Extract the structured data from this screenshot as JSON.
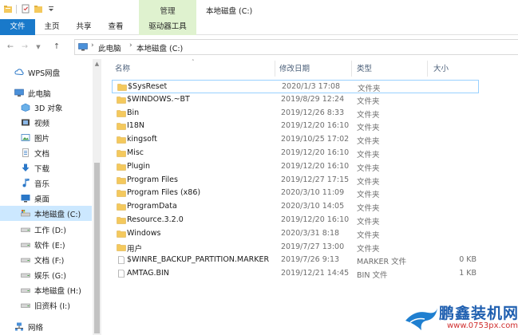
{
  "window": {
    "title": "本地磁盘 (C:)",
    "context_group": "管理"
  },
  "ribbon": {
    "tabs": [
      "文件",
      "主页",
      "共享",
      "查看",
      "驱动器工具"
    ]
  },
  "address": {
    "crumbs": [
      "此电脑",
      "本地磁盘 (C:)"
    ]
  },
  "sidebar": {
    "items": [
      {
        "label": "WPS网盘",
        "icon": "cloud-icon"
      },
      {
        "label": "此电脑",
        "icon": "computer-icon"
      },
      {
        "label": "3D 对象",
        "icon": "3d-objects-icon"
      },
      {
        "label": "视频",
        "icon": "video-icon"
      },
      {
        "label": "图片",
        "icon": "pictures-icon"
      },
      {
        "label": "文档",
        "icon": "documents-icon"
      },
      {
        "label": "下载",
        "icon": "download-icon"
      },
      {
        "label": "音乐",
        "icon": "music-icon"
      },
      {
        "label": "桌面",
        "icon": "desktop-icon"
      },
      {
        "label": "本地磁盘 (C:)",
        "icon": "system-drive-icon"
      },
      {
        "label": "工作 (D:)",
        "icon": "drive-icon"
      },
      {
        "label": "软件 (E:)",
        "icon": "drive-icon"
      },
      {
        "label": "文档 (F:)",
        "icon": "drive-icon"
      },
      {
        "label": "娱乐 (G:)",
        "icon": "drive-icon"
      },
      {
        "label": "本地磁盘 (H:)",
        "icon": "drive-icon"
      },
      {
        "label": "旧资料 (I:)",
        "icon": "drive-icon"
      },
      {
        "label": "网络",
        "icon": "network-icon"
      }
    ]
  },
  "columns": {
    "name": "名称",
    "date": "修改日期",
    "type": "类型",
    "size": "大小"
  },
  "files": [
    {
      "name": "$SysReset",
      "date": "2020/1/3 17:08",
      "type": "文件夹",
      "size": "",
      "icon": "folder-icon"
    },
    {
      "name": "$WINDOWS.~BT",
      "date": "2019/8/29 12:24",
      "type": "文件夹",
      "size": "",
      "icon": "folder-icon"
    },
    {
      "name": "Bin",
      "date": "2019/12/26 8:33",
      "type": "文件夹",
      "size": "",
      "icon": "folder-icon"
    },
    {
      "name": "I18N",
      "date": "2019/12/20 16:10",
      "type": "文件夹",
      "size": "",
      "icon": "folder-icon"
    },
    {
      "name": "kingsoft",
      "date": "2019/10/25 17:02",
      "type": "文件夹",
      "size": "",
      "icon": "folder-icon"
    },
    {
      "name": "Misc",
      "date": "2019/12/20 16:10",
      "type": "文件夹",
      "size": "",
      "icon": "folder-icon"
    },
    {
      "name": "Plugin",
      "date": "2019/12/20 16:10",
      "type": "文件夹",
      "size": "",
      "icon": "folder-icon"
    },
    {
      "name": "Program Files",
      "date": "2019/12/27 17:15",
      "type": "文件夹",
      "size": "",
      "icon": "folder-icon"
    },
    {
      "name": "Program Files (x86)",
      "date": "2020/3/10 11:09",
      "type": "文件夹",
      "size": "",
      "icon": "folder-icon"
    },
    {
      "name": "ProgramData",
      "date": "2020/3/10 14:05",
      "type": "文件夹",
      "size": "",
      "icon": "folder-icon"
    },
    {
      "name": "Resource.3.2.0",
      "date": "2019/12/20 16:10",
      "type": "文件夹",
      "size": "",
      "icon": "folder-icon"
    },
    {
      "name": "Windows",
      "date": "2020/3/31 8:18",
      "type": "文件夹",
      "size": "",
      "icon": "folder-icon"
    },
    {
      "name": "用户",
      "date": "2019/7/27 13:00",
      "type": "文件夹",
      "size": "",
      "icon": "folder-icon"
    },
    {
      "name": "$WINRE_BACKUP_PARTITION.MARKER",
      "date": "2019/7/26 9:13",
      "type": "MARKER 文件",
      "size": "0 KB",
      "icon": "file-icon"
    },
    {
      "name": "AMTAG.BIN",
      "date": "2019/12/21 14:45",
      "type": "BIN 文件",
      "size": "1 KB",
      "icon": "file-icon"
    }
  ],
  "watermark": {
    "brand": "鹏鑫装机网",
    "url": "www.0753px.com"
  },
  "colors": {
    "accent": "#1979ca",
    "selection": "#cce8ff",
    "folder": "#f4c95d",
    "context_tab": "#dff2cf"
  }
}
